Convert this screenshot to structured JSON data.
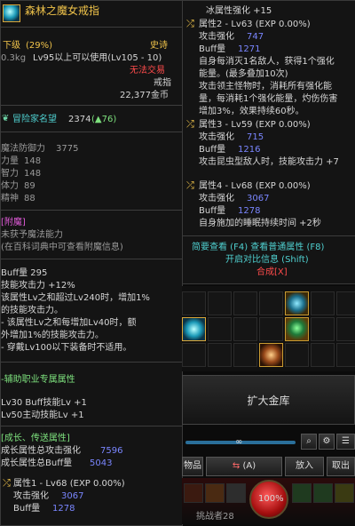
{
  "item": {
    "name": "森林之魔女戒指",
    "grade_label": "下级",
    "grade_pct": "(29%)",
    "rarity": "史诗",
    "weight": "0.3kg",
    "level_req": "Lv95以上可以使用(Lv105 - 10)",
    "trade": "无法交易",
    "type": "戒指",
    "price": "22,377金币",
    "fame_label": "冒险家名望",
    "fame_value": "2374",
    "fame_delta": "(▲76)"
  },
  "stats": [
    {
      "name": "魔法防御力",
      "value": "3775"
    },
    {
      "name": "力量",
      "value": "148"
    },
    {
      "name": "智力",
      "value": "148"
    },
    {
      "name": "体力",
      "value": "89"
    },
    {
      "name": "精神",
      "value": "88"
    }
  ],
  "enchant": {
    "title": "附魔",
    "line1": "未获予魔法能力",
    "line2": "(在百科词典中可查看附魔信息)"
  },
  "buff": {
    "title": "Buff量 295",
    "lines": [
      "技能攻击力 +12%",
      "该属性Lv之和超过Lv240时，增加1%",
      "的技能攻击力。",
      "- 该属性Lv之和每增加Lv40时，额",
      "外增加1%的技能攻击力。",
      "- 穿戴Lv100以下装备时不适用。"
    ]
  },
  "support": {
    "title": "辅助职业专属属性",
    "lines": [
      "Lv30 Buff技能Lv +1",
      "Lv50主动技能Lv +1"
    ]
  },
  "growth": {
    "title": "成长、传送属性",
    "atk_label": "成长属性总攻击强化",
    "atk_value": "7596",
    "buff_label": "成长属性总Buff量",
    "buff_value": "5043",
    "attr1_title": "属性1 - Lv68 (EXP 0.00%)",
    "attr1_atk_label": "攻击强化",
    "attr1_atk_value": "3067",
    "attr1_buff_label": "Buff量",
    "attr1_buff_value": "1278"
  },
  "right": {
    "top_line": "冰属性强化 +15",
    "attr2_title": "属性2 - Lv63 (EXP 0.00%)",
    "attr2_atk_label": "攻击强化",
    "attr2_atk_value": "747",
    "attr2_buff_label": "Buff量",
    "attr2_buff_value": "1271",
    "attr2_desc": [
      "自身每消灭1名敌人，获得1个强化",
      "能量。(最多叠加10次)",
      "攻击领主怪物时，消耗所有强化能",
      "量，每消耗1个强化能量，灼伤伤害",
      "增加3%，效果持续60秒。"
    ],
    "attr3_title": "属性3 - Lv59 (EXP 0.00%)",
    "attr3_atk_label": "攻击强化",
    "attr3_atk_value": "715",
    "attr3_buff_label": "Buff量",
    "attr3_buff_value": "1216",
    "attr3_desc": "攻击昆虫型敌人时，技能攻击力 +7",
    "attr4_title": "属性4 - Lv68 (EXP 0.00%)",
    "attr4_atk_label": "攻击强化",
    "attr4_atk_value": "3067",
    "attr4_buff_label": "Buff量",
    "attr4_buff_value": "1278",
    "attr4_desc": "自身施加的睡眠持续时间 +2秒",
    "compare_line": "简要查看 (F4) 查看普通属性 (F8)",
    "compare_line2": "开启对比信息 (Shift)",
    "synth": "合成[X]"
  },
  "storage": {
    "expand_label": "扩大金库",
    "slider_mark": "∞",
    "tab_items": "物品",
    "sort_label": "(A)",
    "deposit": "放入",
    "withdraw": "取出"
  },
  "hud": {
    "hp_pct": "100%",
    "status_text": "挑战者28"
  },
  "colors": {
    "epic": "#f0c34a",
    "accent_cyan": "#4fd0d0",
    "value_blue": "#7a86ff",
    "red_text": "#ff4b4b",
    "magenta_text": "#e05bd8"
  }
}
